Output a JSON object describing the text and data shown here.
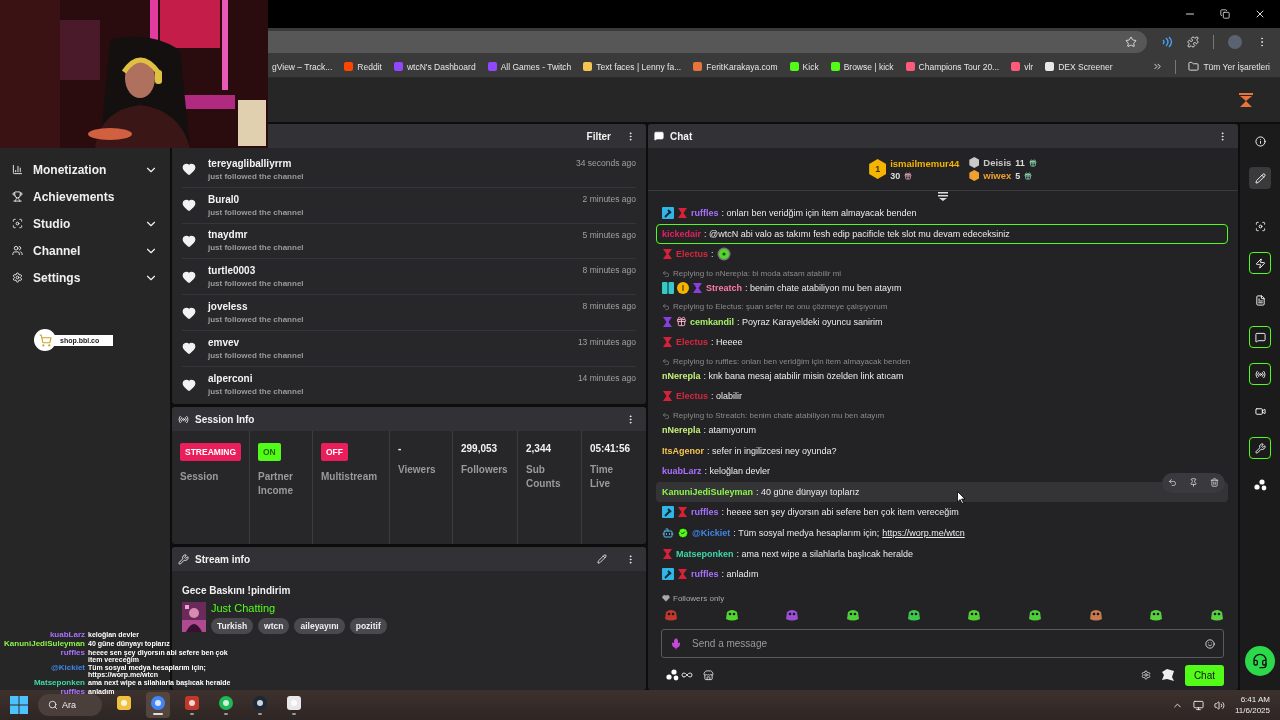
{
  "bookmarks": [
    {
      "label": "gView – Track..."
    },
    {
      "label": "Reddit",
      "color": "#ff4500"
    },
    {
      "label": "wtcN's Dashboard",
      "color": "#9146ff"
    },
    {
      "label": "All Games - Twitch",
      "color": "#9146ff"
    },
    {
      "label": "Text faces | Lenny fa...",
      "color": "#f5c451"
    },
    {
      "label": "FeritKarakaya.com",
      "color": "#e8743b"
    },
    {
      "label": "Kick",
      "color": "#53fc18"
    },
    {
      "label": "Browse | kick",
      "color": "#53fc18"
    },
    {
      "label": "Champions Tour 20...",
      "color": "#ff5a7a"
    },
    {
      "label": "vlr",
      "color": "#ff5a7a"
    },
    {
      "label": "DEX Screener",
      "color": "#e8e8e8"
    }
  ],
  "bookmarks_folder": "Tüm Yer İşaretleri",
  "sidebar": {
    "items": [
      {
        "label": "Monetization",
        "expandable": true
      },
      {
        "label": "Achievements",
        "expandable": false
      },
      {
        "label": "Studio",
        "expandable": true
      },
      {
        "label": "Channel",
        "expandable": true
      },
      {
        "label": "Settings",
        "expandable": true
      }
    ],
    "shop_link": "shop.bbl.co"
  },
  "followers": {
    "filter": "Filter",
    "items": [
      {
        "name": "tereyaglibalIiyrrm",
        "action": "just followed the channel",
        "time": "34 seconds ago"
      },
      {
        "name": "Bural0",
        "action": "just followed the channel",
        "time": "2 minutes ago"
      },
      {
        "name": "tnaydmr",
        "action": "just followed the channel",
        "time": "5 minutes ago"
      },
      {
        "name": "turtle0003",
        "action": "just followed the channel",
        "time": "8 minutes ago"
      },
      {
        "name": "joveless",
        "action": "just followed the channel",
        "time": "8 minutes ago"
      },
      {
        "name": "emvev",
        "action": "just followed the channel",
        "time": "13 minutes ago"
      },
      {
        "name": "alperconi",
        "action": "just followed the channel",
        "time": "14 minutes ago"
      }
    ]
  },
  "session_info": {
    "title": "Session Info",
    "stats": [
      {
        "kind": "badge",
        "value": "STREAMING",
        "label": "Session",
        "color": "#e91e5a"
      },
      {
        "kind": "badge",
        "value": "ON",
        "label": "Partner Income",
        "color": "#53fc18"
      },
      {
        "kind": "badge",
        "value": "OFF",
        "label": "Multistream",
        "color": "#e91e5a"
      },
      {
        "kind": "number",
        "value": "-",
        "label": "Viewers"
      },
      {
        "kind": "number",
        "value": "299,053",
        "label": "Followers"
      },
      {
        "kind": "number",
        "value": "2,344",
        "label": "Sub Counts"
      },
      {
        "kind": "number",
        "value": "05:41:56",
        "label": "Time Live"
      }
    ]
  },
  "stream_info": {
    "title": "Stream info",
    "stream_title": "Gece Baskını !pindirim",
    "category": "Just Chatting",
    "tags": [
      "Turkish",
      "wtcn",
      "aileyayını",
      "pozitif"
    ]
  },
  "chat": {
    "title": "Chat",
    "leader": {
      "rank": "1",
      "name": "ismailmemur44",
      "count": "30",
      "color": "#f5b400"
    },
    "runners_up": [
      {
        "name": "Deisis",
        "count": "11",
        "color": "#c9c9c9"
      },
      {
        "name": "wiwex",
        "count": "5",
        "color": "#f0a030"
      }
    ],
    "messages": [
      {
        "kind": "message",
        "badges": [
          {
            "kind": "moderator"
          },
          {
            "kind": "founder"
          }
        ],
        "user": "ruffles",
        "color": "#a970ff",
        "text": ": onları ben veridğim için item almayacak benden",
        "highlighted": false,
        "hovered": false
      },
      {
        "kind": "message",
        "user": "kickedair",
        "color": "#e0245e",
        "text": ": @wtcN abi valo as takımı fesh edip pacificle tek slot mu devam edeceksiniz",
        "highlighted": true,
        "hovered": false
      },
      {
        "kind": "message",
        "badges": [
          {
            "kind": "founder"
          }
        ],
        "user": "Electus",
        "color": "#d9263f",
        "text": ":",
        "emote": true,
        "highlighted": false,
        "hovered": false
      },
      {
        "kind": "reply",
        "text": "Replying to nNerepla: bi moda atsam atabilir mi"
      },
      {
        "kind": "message",
        "badges": [
          {
            "kind": "og"
          },
          {
            "kind": "subscriber"
          },
          {
            "kind": "vip"
          }
        ],
        "user": "Streatch",
        "color": "#ff7aa8",
        "text": ": benim chate atabiliyon mu ben atayım",
        "highlighted": false,
        "hovered": false
      },
      {
        "kind": "reply",
        "text": "Replying to Electus: şuan sefer ne onu çözmeye çalışıyorum"
      },
      {
        "kind": "message",
        "badges": [
          {
            "kind": "vip"
          },
          {
            "kind": "sub_gifter"
          }
        ],
        "user": "cemkandil",
        "color": "#a8f06a",
        "text": ": Poyraz Karayeldeki oyuncu sanirim",
        "highlighted": false,
        "hovered": false
      },
      {
        "kind": "message",
        "badges": [
          {
            "kind": "founder"
          }
        ],
        "user": "Electus",
        "color": "#d9263f",
        "text": ": Heeee",
        "highlighted": false,
        "hovered": false
      },
      {
        "kind": "reply",
        "text": "Replying to ruffles: onları ben veridğim için item almayacak benden"
      },
      {
        "kind": "message",
        "user": "nNerepla",
        "color": "#c4f07a",
        "text": ": knk bana mesaj atabilir misin özelden link atıcam",
        "highlighted": false,
        "hovered": false
      },
      {
        "kind": "message",
        "badges": [
          {
            "kind": "founder"
          }
        ],
        "user": "Electus",
        "color": "#d9263f",
        "text": ": olabilir",
        "highlighted": false,
        "hovered": false
      },
      {
        "kind": "reply",
        "text": "Replying to Streatch: benim chate atabiliyon mu ben atayım"
      },
      {
        "kind": "message",
        "user": "nNerepla",
        "color": "#c4f07a",
        "text": ": atamıyorum",
        "highlighted": false,
        "hovered": false
      },
      {
        "kind": "message",
        "user": "ItsAgenor",
        "color": "#f5c451",
        "text": ": sefer in ingilizcesi ney oyunda?",
        "highlighted": false,
        "hovered": false
      },
      {
        "kind": "message",
        "user": "kuabLarz",
        "color": "#a970ff",
        "text": ": keloğlan devler",
        "highlighted": false,
        "hovered": false
      },
      {
        "kind": "message",
        "user": "KanuniJediSuleyman",
        "color": "#8cf54a",
        "text": ": 40 güne dünyayı toplarız",
        "highlighted": false,
        "hovered": true
      },
      {
        "kind": "message",
        "badges": [
          {
            "kind": "moderator"
          },
          {
            "kind": "founder"
          }
        ],
        "user": "ruffles",
        "color": "#a970ff",
        "text": ": heeee sen şey diyorsın abi sefere ben çok item vereceğim",
        "highlighted": false,
        "hovered": false
      },
      {
        "kind": "message",
        "badges": [
          {
            "kind": "bot"
          },
          {
            "kind": "verified"
          }
        ],
        "user": "@Kickiet",
        "color": "#3f86e8",
        "text": ": Tüm sosyal medya hesaplarım için;",
        "link": "https://worp.me/wtcn",
        "highlighted": false,
        "hovered": false
      },
      {
        "kind": "message",
        "badges": [
          {
            "kind": "founder"
          }
        ],
        "user": "Matseponken",
        "color": "#3fd8a8",
        "text": ": ama next wipe a silahlarla başlıcak heralde",
        "highlighted": false,
        "hovered": false
      },
      {
        "kind": "message",
        "badges": [
          {
            "kind": "moderator"
          },
          {
            "kind": "founder"
          }
        ],
        "user": "ruffles",
        "color": "#a970ff",
        "text": ": anladım",
        "highlighted": false,
        "hovered": false
      }
    ],
    "followers_only": "Followers only",
    "input": {
      "placeholder": "Send a message"
    },
    "send": "Chat"
  },
  "rail": [
    {
      "selected": false,
      "active": false
    },
    {
      "selected": true,
      "active": false
    },
    {
      "selected": false,
      "active": false
    },
    {
      "selected": false,
      "active": true
    },
    {
      "selected": false,
      "active": false
    },
    {
      "selected": false,
      "active": true
    },
    {
      "selected": false,
      "active": true
    },
    {
      "selected": false,
      "active": false
    },
    {
      "selected": false,
      "active": true
    },
    {
      "selected": false,
      "active": false
    }
  ],
  "stream_overlay": [
    {
      "user": "kuabLarz",
      "color": "#a970ff",
      "text": "keloğlan devler"
    },
    {
      "user": "KanuniJediSuleyman",
      "color": "#8cf54a",
      "text": "40 güne dünyayı toplarız"
    },
    {
      "user": "ruffles",
      "color": "#a970ff",
      "text": "heeee sen şey diyorsın abi sefere ben çok item vereceğim"
    },
    {
      "user": "@Kickiet",
      "color": "#3f86e8",
      "text": "Tüm sosyal medya hesaplarım için; https://worp.me/wtcn"
    },
    {
      "user": "Matseponken",
      "color": "#3fd8a8",
      "text": "ama next wipe a silahlarla başlıcak heralde"
    },
    {
      "user": "ruffles",
      "color": "#a970ff",
      "text": "anladım"
    }
  ],
  "taskbar": {
    "search": "Ara",
    "apps": [
      {
        "open": false,
        "active": false
      },
      {
        "open": true,
        "active": true
      },
      {
        "open": true,
        "active": false
      },
      {
        "open": true,
        "active": false
      },
      {
        "open": true,
        "active": false
      },
      {
        "open": true,
        "active": false
      }
    ],
    "time": "6:41 AM",
    "date": "11/6/2025"
  }
}
